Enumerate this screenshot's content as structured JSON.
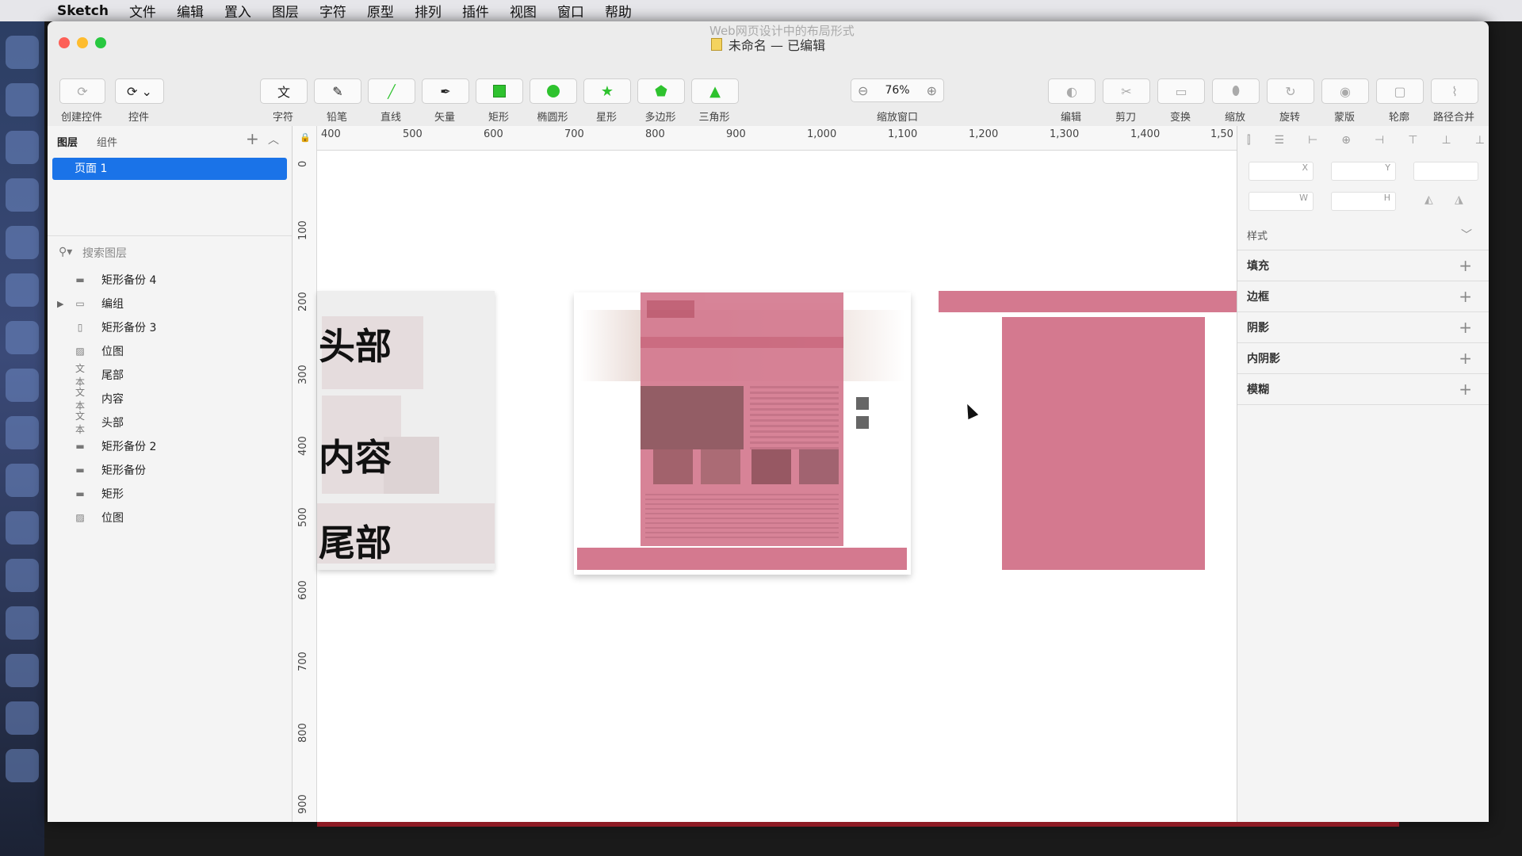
{
  "menubar": {
    "app_name": "Sketch",
    "items": [
      "文件",
      "编辑",
      "置入",
      "图层",
      "字符",
      "原型",
      "排列",
      "插件",
      "视图",
      "窗口",
      "帮助"
    ]
  },
  "window": {
    "title": "未命名 — 已编辑",
    "watermark_overlay_title": "Web网页设计中的布局形式"
  },
  "toolbar": {
    "create_symbol": "创建控件",
    "symbols": "控件",
    "text": "字符",
    "pencil": "铅笔",
    "line": "直线",
    "vector": "矢量",
    "rectangle": "矩形",
    "oval": "椭圆形",
    "star": "星形",
    "polygon": "多边形",
    "triangle": "三角形",
    "zoom_value": "76%",
    "zoom_label": "缩放窗口",
    "edit": "编辑",
    "scissors": "剪刀",
    "transform": "变换",
    "scale": "缩放",
    "rotate": "旋转",
    "mask": "蒙版",
    "outline": "轮廓",
    "path_combine": "路径合并"
  },
  "left_panel": {
    "tab_layers": "图层",
    "tab_components": "组件",
    "page_selected": "页面 1",
    "search_placeholder": "搜索图层",
    "layers": [
      {
        "icon": "rect-line-icon",
        "type_label": "",
        "name": "矩形备份 4"
      },
      {
        "icon": "folder-icon",
        "type_label": "",
        "name": "编组"
      },
      {
        "icon": "rect-icon",
        "type_label": "",
        "name": "矩形备份 3"
      },
      {
        "icon": "image-icon",
        "type_label": "",
        "name": "位图"
      },
      {
        "icon": "text-icon",
        "type_label": "文本",
        "name": "尾部"
      },
      {
        "icon": "text-icon",
        "type_label": "文本",
        "name": "内容"
      },
      {
        "icon": "text-icon",
        "type_label": "文本",
        "name": "头部"
      },
      {
        "icon": "rect-line-icon",
        "type_label": "",
        "name": "矩形备份 2"
      },
      {
        "icon": "rect-line-icon",
        "type_label": "",
        "name": "矩形备份"
      },
      {
        "icon": "rect-line-icon",
        "type_label": "",
        "name": "矩形"
      },
      {
        "icon": "image-icon",
        "type_label": "",
        "name": "位图"
      }
    ]
  },
  "ruler": {
    "h_ticks": [
      "400",
      "500",
      "600",
      "700",
      "800",
      "900",
      "1,000",
      "1,100",
      "1,200",
      "1,300",
      "1,400",
      "1,50"
    ],
    "v_ticks": [
      "0",
      "100",
      "200",
      "300",
      "400",
      "500",
      "600",
      "700",
      "800",
      "900"
    ]
  },
  "canvas": {
    "label_head": "头部",
    "label_content": "内容",
    "label_foot": "尾部"
  },
  "right_panel": {
    "x_label": "X",
    "y_label": "Y",
    "w_label": "W",
    "h_label": "H",
    "style_header": "样式",
    "fill": "填充",
    "border": "边框",
    "shadow": "阴影",
    "inner_shadow": "内阴影",
    "blur": "模糊"
  },
  "colors": {
    "pink": "#d4798f",
    "selection_blue": "#1a73e8",
    "green_tool": "#2ec22e"
  }
}
